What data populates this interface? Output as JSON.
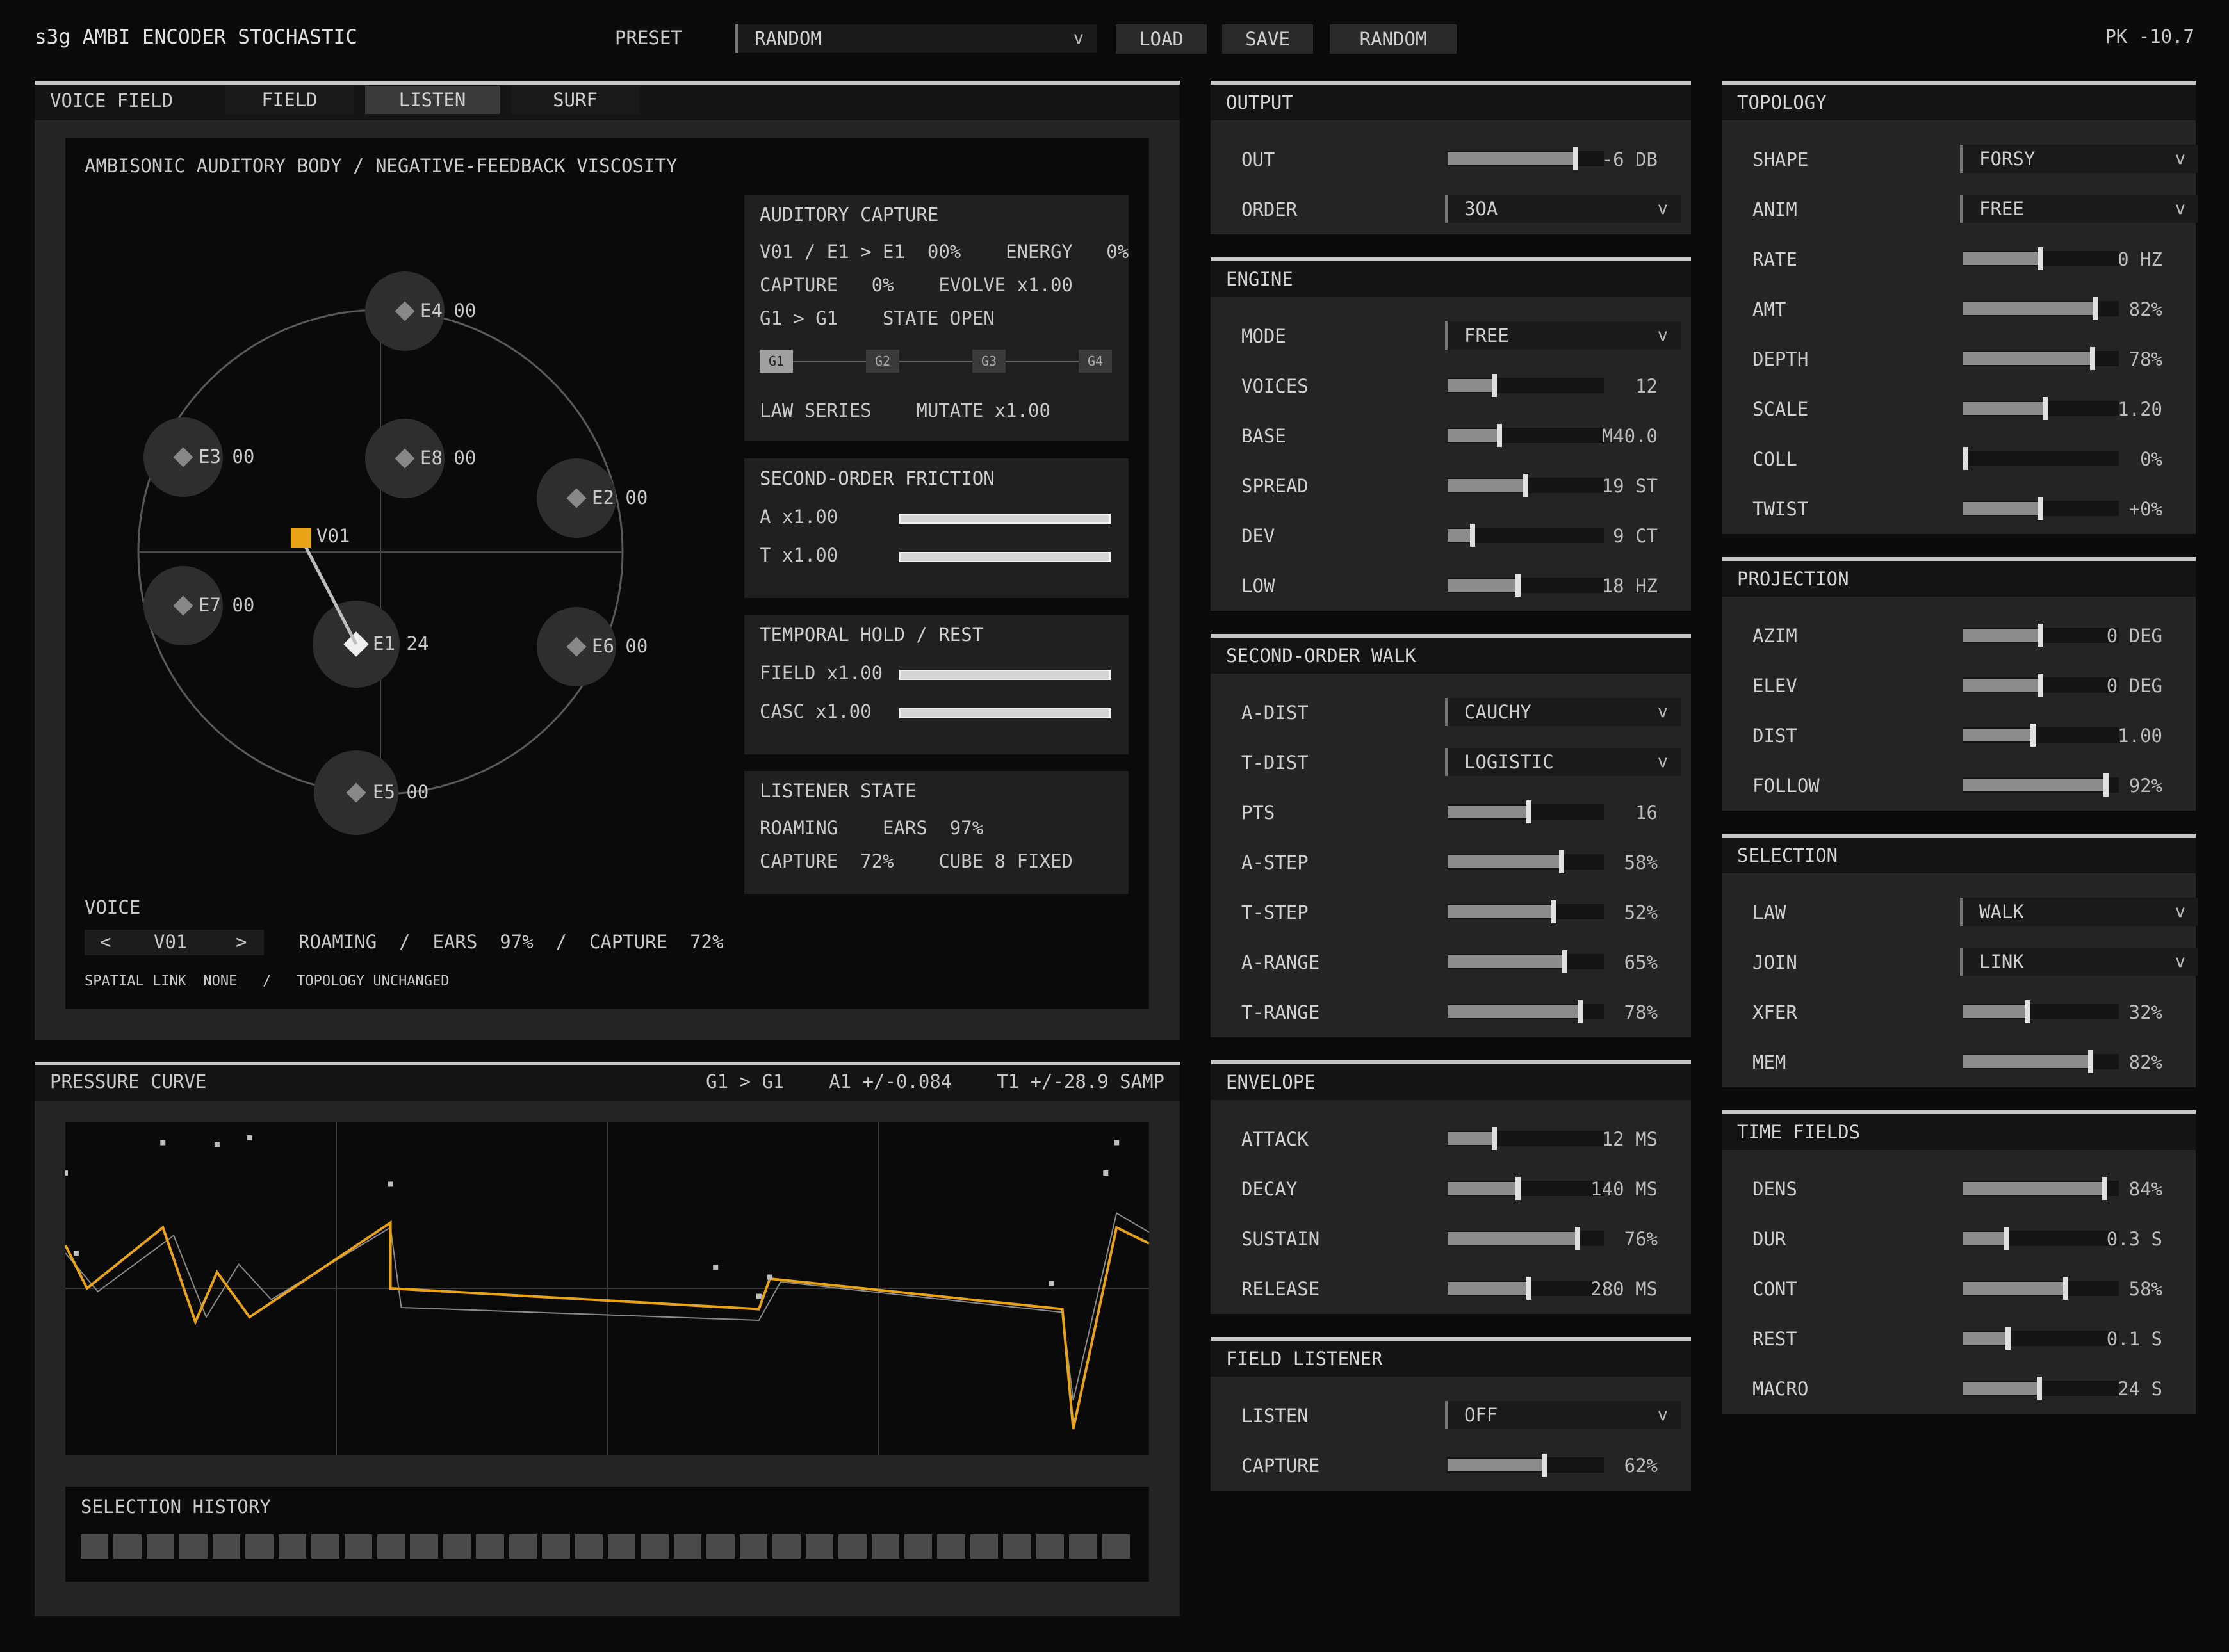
{
  "header": {
    "app_title": "s3g AMBI ENCODER STOCHASTIC",
    "preset_label": "PRESET",
    "preset_value": "RANDOM",
    "caret": "v",
    "load": "LOAD",
    "save": "SAVE",
    "random": "RANDOM",
    "peak": "PK -10.7"
  },
  "voice_panel": {
    "title": "VOICE FIELD",
    "tabs": [
      "FIELD",
      "LISTEN",
      "SURF"
    ],
    "active_tab": "LISTEN",
    "field_title": "AMBISONIC AUDITORY BODY / NEGATIVE-FEEDBACK VISCOSITY",
    "emitters": [
      {
        "name": "E4",
        "count": "00"
      },
      {
        "name": "E3",
        "count": "00"
      },
      {
        "name": "E8",
        "count": "00"
      },
      {
        "name": "E2",
        "count": "00"
      },
      {
        "name": "E7",
        "count": "00"
      },
      {
        "name": "E1",
        "count": "24"
      },
      {
        "name": "E6",
        "count": "00"
      },
      {
        "name": "E5",
        "count": "00"
      }
    ],
    "voice_marker": "V01",
    "auditory_capture": {
      "title": "AUDITORY CAPTURE",
      "line1": "V01 / E1 > E1  00%    ENERGY   0%",
      "line2": "CAPTURE   0%    EVOLVE x1.00",
      "line3": "G1 > G1    STATE OPEN",
      "gates": [
        "G1",
        "G2",
        "G3",
        "G4"
      ],
      "line4": "LAW SERIES    MUTATE x1.00"
    },
    "friction": {
      "title": "SECOND-ORDER FRICTION",
      "a": "A x1.00",
      "t": "T x1.00"
    },
    "temporal": {
      "title": "TEMPORAL HOLD / REST",
      "field": "FIELD x1.00",
      "casc": "CASC x1.00"
    },
    "listener": {
      "title": "LISTENER STATE",
      "line1": "ROAMING    EARS  97%",
      "line2": "CAPTURE  72%    CUBE 8 FIXED"
    },
    "voice_label": "VOICE",
    "prev": "<",
    "voice_id": "V01",
    "next": ">",
    "voice_status": "ROAMING  /  EARS  97%  /  CAPTURE  72%",
    "link_status": "SPATIAL LINK  NONE   /   TOPOLOGY UNCHANGED"
  },
  "pressure": {
    "title": "PRESSURE CURVE",
    "stats": "G1 > G1    A1 +/-0.084    T1 +/-28.9 SAMP",
    "history_title": "SELECTION HISTORY",
    "history_cells": 32
  },
  "chart_data": {
    "type": "line",
    "title": "PRESSURE CURVE",
    "xlim": [
      0,
      1
    ],
    "ylim": [
      -1,
      1
    ],
    "series": [
      {
        "color": "#e8a317",
        "x": [
          0,
          0.02,
          0.09,
          0.12,
          0.14,
          0.17,
          0.3,
          0.3,
          0.64,
          0.65,
          0.92,
          0.93,
          0.97,
          1
        ],
        "y": [
          0.27,
          0.0,
          0.38,
          -0.21,
          0.1,
          -0.18,
          0.41,
          0.0,
          -0.13,
          0.06,
          -0.13,
          -0.88,
          0.38,
          0.28
        ]
      },
      {
        "color": "#8a8a8a",
        "x": [
          0,
          0.03,
          0.1,
          0.13,
          0.16,
          0.19,
          0.3,
          0.31,
          0.64,
          0.66,
          0.92,
          0.93,
          0.97,
          1
        ],
        "y": [
          0.22,
          -0.02,
          0.33,
          -0.18,
          0.15,
          -0.07,
          0.38,
          -0.12,
          -0.2,
          0.04,
          -0.15,
          -0.7,
          0.47,
          0.35
        ]
      }
    ],
    "points": {
      "x": [
        0,
        0.01,
        0.09,
        0.14,
        0.17,
        0.3,
        0.6,
        0.64,
        0.65,
        0.91,
        0.96,
        0.97
      ],
      "y": [
        0.72,
        0.22,
        0.91,
        0.9,
        0.94,
        0.65,
        0.13,
        -0.05,
        0.07,
        0.03,
        0.72,
        0.91
      ]
    }
  },
  "output": {
    "title": "OUTPUT",
    "rows": [
      {
        "label": "OUT",
        "type": "slider",
        "value": "-6 DB",
        "level": 0.82
      },
      {
        "label": "ORDER",
        "type": "dropdown",
        "value": "3OA"
      }
    ]
  },
  "engine": {
    "title": "ENGINE",
    "rows": [
      {
        "label": "MODE",
        "type": "dropdown",
        "value": "FREE"
      },
      {
        "label": "VOICES",
        "type": "slider",
        "value": "12",
        "level": 0.3
      },
      {
        "label": "BASE",
        "type": "slider",
        "value": "M40.0",
        "level": 0.33
      },
      {
        "label": "SPREAD",
        "type": "slider",
        "value": "19 ST",
        "level": 0.5
      },
      {
        "label": "DEV",
        "type": "slider",
        "value": "9 CT",
        "level": 0.16
      },
      {
        "label": "LOW",
        "type": "slider",
        "value": "18 HZ",
        "level": 0.45
      }
    ]
  },
  "walk": {
    "title": "SECOND-ORDER WALK",
    "rows": [
      {
        "label": "A-DIST",
        "type": "dropdown",
        "value": "CAUCHY"
      },
      {
        "label": "T-DIST",
        "type": "dropdown",
        "value": "LOGISTIC"
      },
      {
        "label": "PTS",
        "type": "slider",
        "value": "16",
        "level": 0.52
      },
      {
        "label": "A-STEP",
        "type": "slider",
        "value": "58%",
        "level": 0.73
      },
      {
        "label": "T-STEP",
        "type": "slider",
        "value": "52%",
        "level": 0.68
      },
      {
        "label": "A-RANGE",
        "type": "slider",
        "value": "65%",
        "level": 0.75
      },
      {
        "label": "T-RANGE",
        "type": "slider",
        "value": "78%",
        "level": 0.85
      }
    ]
  },
  "envelope": {
    "title": "ENVELOPE",
    "rows": [
      {
        "label": "ATTACK",
        "type": "slider",
        "value": "12 MS",
        "level": 0.3
      },
      {
        "label": "DECAY",
        "type": "slider",
        "value": "140 MS",
        "level": 0.45
      },
      {
        "label": "SUSTAIN",
        "type": "slider",
        "value": "76%",
        "level": 0.83
      },
      {
        "label": "RELEASE",
        "type": "slider",
        "value": "280 MS",
        "level": 0.52
      }
    ]
  },
  "field_listener": {
    "title": "FIELD LISTENER",
    "rows": [
      {
        "label": "LISTEN",
        "type": "dropdown",
        "value": "OFF"
      },
      {
        "label": "CAPTURE",
        "type": "slider",
        "value": "62%",
        "level": 0.62
      }
    ]
  },
  "topology": {
    "title": "TOPOLOGY",
    "rows": [
      {
        "label": "SHAPE",
        "type": "dropdown",
        "value": "FORSY"
      },
      {
        "label": "ANIM",
        "type": "dropdown",
        "value": "FREE"
      },
      {
        "label": "RATE",
        "type": "slider",
        "value": "0 HZ",
        "level": 0.5
      },
      {
        "label": "AMT",
        "type": "slider",
        "value": "82%",
        "level": 0.85
      },
      {
        "label": "DEPTH",
        "type": "slider",
        "value": "78%",
        "level": 0.83
      },
      {
        "label": "SCALE",
        "type": "slider",
        "value": "1.20",
        "level": 0.53
      },
      {
        "label": "COLL",
        "type": "slider",
        "value": "0%",
        "level": 0.02
      },
      {
        "label": "TWIST",
        "type": "slider",
        "value": "+0%",
        "level": 0.5
      }
    ]
  },
  "projection": {
    "title": "PROJECTION",
    "rows": [
      {
        "label": "AZIM",
        "type": "slider",
        "value": "0 DEG",
        "level": 0.5
      },
      {
        "label": "ELEV",
        "type": "slider",
        "value": "0 DEG",
        "level": 0.5
      },
      {
        "label": "DIST",
        "type": "slider",
        "value": "1.00",
        "level": 0.45
      },
      {
        "label": "FOLLOW",
        "type": "slider",
        "value": "92%",
        "level": 0.92
      }
    ]
  },
  "selection": {
    "title": "SELECTION",
    "rows": [
      {
        "label": "LAW",
        "type": "dropdown",
        "value": "WALK"
      },
      {
        "label": "JOIN",
        "type": "dropdown",
        "value": "LINK"
      },
      {
        "label": "XFER",
        "type": "slider",
        "value": "32%",
        "level": 0.42
      },
      {
        "label": "MEM",
        "type": "slider",
        "value": "82%",
        "level": 0.82
      }
    ]
  },
  "time_fields": {
    "title": "TIME FIELDS",
    "rows": [
      {
        "label": "DENS",
        "type": "slider",
        "value": "84%",
        "level": 0.91
      },
      {
        "label": "DUR",
        "type": "slider",
        "value": "0.3 S",
        "level": 0.28
      },
      {
        "label": "CONT",
        "type": "slider",
        "value": "58%",
        "level": 0.66
      },
      {
        "label": "REST",
        "type": "slider",
        "value": "0.1 S",
        "level": 0.29
      },
      {
        "label": "MACRO",
        "type": "slider",
        "value": "24 S",
        "level": 0.49
      }
    ]
  }
}
